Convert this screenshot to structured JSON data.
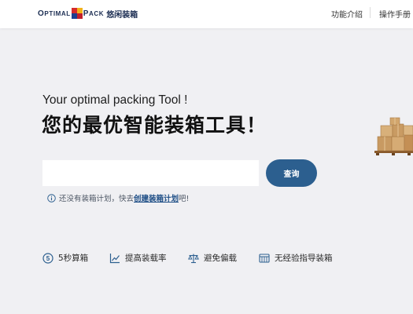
{
  "header": {
    "logo": {
      "word_part1_big": "O",
      "word_part1_small": "PTIMAL",
      "word_part2_big": "P",
      "word_part2_small": "ACK",
      "chinese": "悠闲装箱"
    },
    "nav": [
      {
        "label": "功能介绍"
      },
      {
        "label": "操作手册"
      }
    ]
  },
  "hero": {
    "subtitle": "Your optimal packing Tool !",
    "title": "您的最优智能装箱工具！"
  },
  "search": {
    "value": "",
    "placeholder": "",
    "button_label": "查询"
  },
  "hint": {
    "prefix": "还没有装箱计划，快去",
    "link": "创建装箱计划",
    "suffix": "吧!"
  },
  "features": [
    {
      "label": "5秒算箱",
      "icon": "five-seconds-icon"
    },
    {
      "label": "提高装载率",
      "icon": "trend-chart-icon"
    },
    {
      "label": "避免偏载",
      "icon": "balance-scale-icon"
    },
    {
      "label": "无经验指导装箱",
      "icon": "guide-board-icon"
    }
  ],
  "colors": {
    "accent": "#2c5f8f",
    "link": "#1e4e86",
    "background": "#f0f0f3",
    "icon": "#2c5f8f"
  }
}
